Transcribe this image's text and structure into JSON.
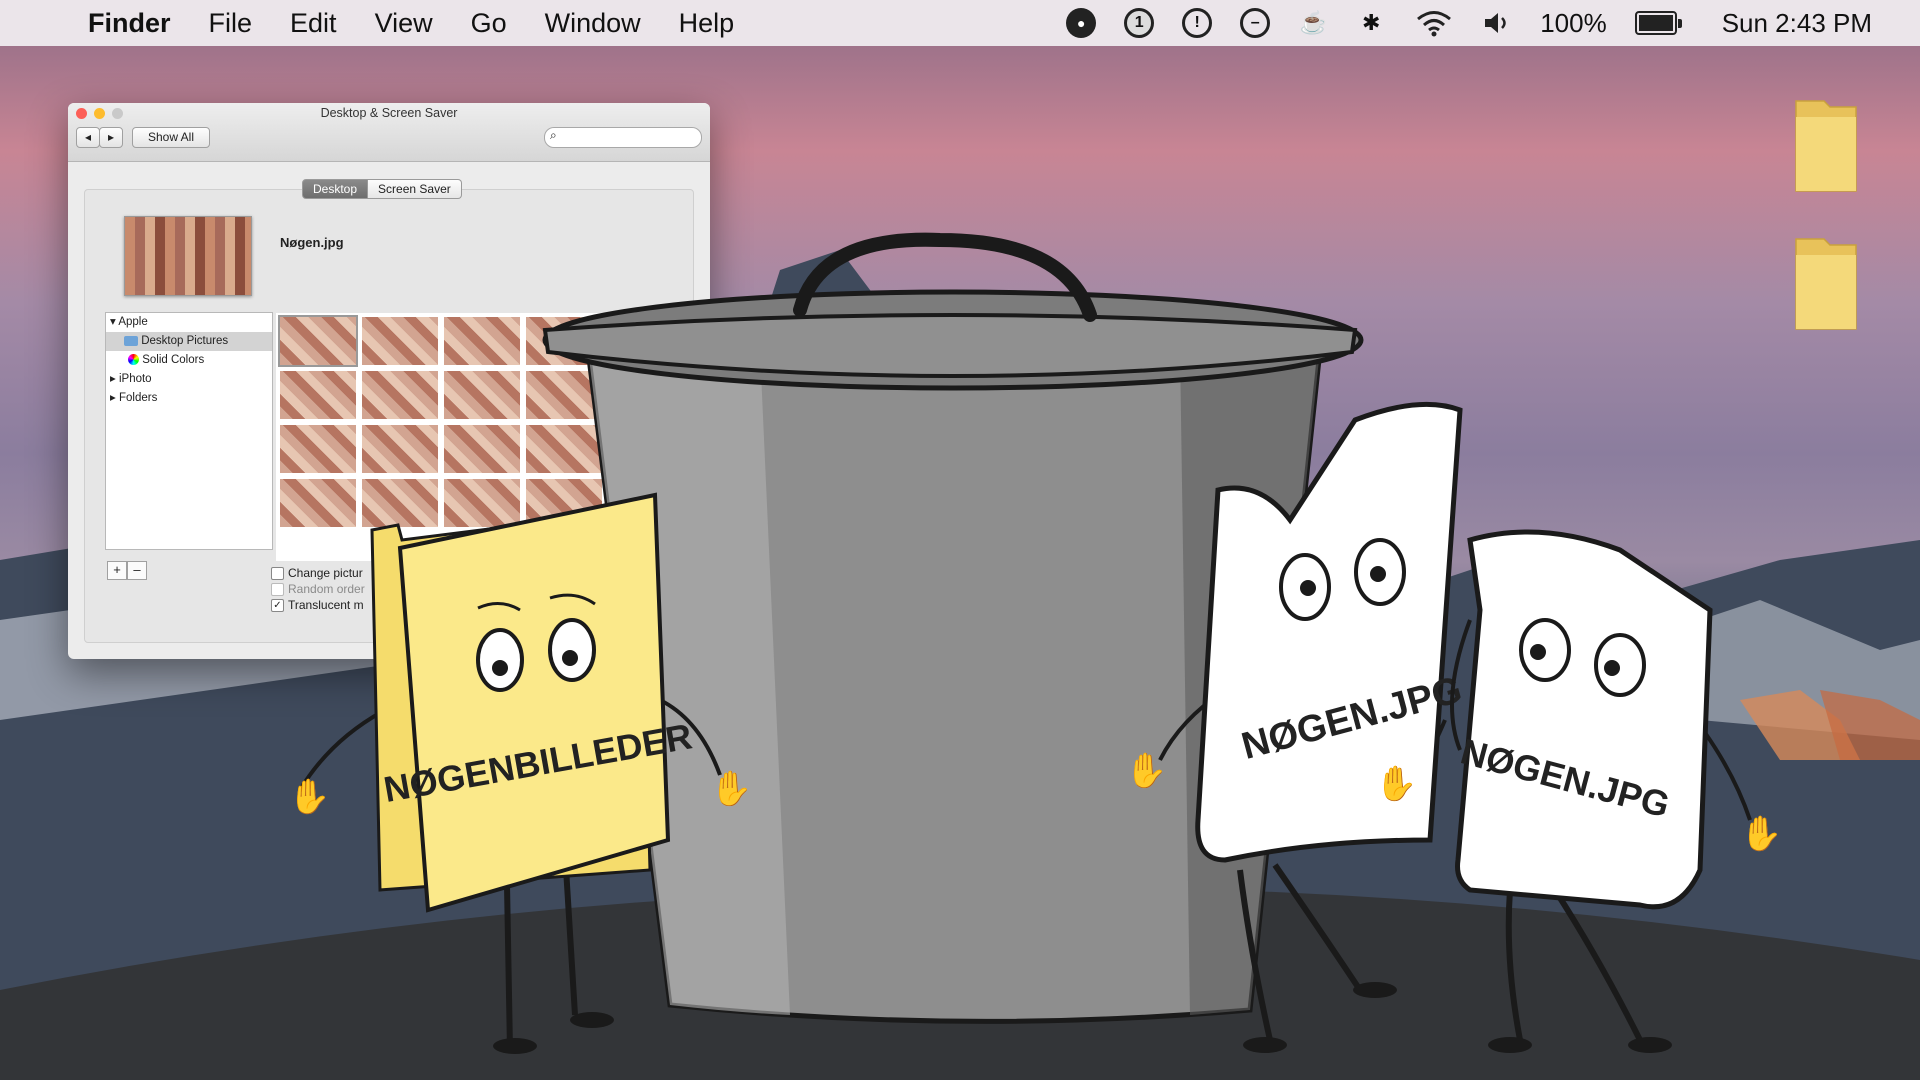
{
  "menubar": {
    "apple_glyph": "",
    "app_name": "Finder",
    "menus": [
      "File",
      "Edit",
      "View",
      "Go",
      "Window",
      "Help"
    ],
    "status": {
      "one_password_badge": "1",
      "battery_percent": "100%",
      "battery_level": 1.0,
      "clock": "Sun 2:43 PM"
    }
  },
  "prefs_window": {
    "title": "Desktop & Screen Saver",
    "show_all_label": "Show All",
    "search_placeholder": "",
    "tabs": [
      "Desktop",
      "Screen Saver"
    ],
    "active_tab": "Desktop",
    "current_picture": "Nøgen.jpg",
    "sources": {
      "group_apple": "Apple",
      "desktop_pictures": "Desktop Pictures",
      "solid_colors": "Solid Colors",
      "iphoto": "iPhoto",
      "folders": "Folders"
    },
    "buttons": {
      "add": "+",
      "remove": "–"
    },
    "options": {
      "change_picture": "Change pictur",
      "random_order": "Random order",
      "translucent_menu": "Translucent m"
    },
    "translucent_checked_glyph": "✓"
  },
  "scene": {
    "folder_character_label": "NØGENBILLEDER",
    "file_character_1_label": "NØGEN.JPG",
    "file_character_2_label": "NØGEN.JPG"
  },
  "colors": {
    "folder_yellow": "#fbe98a",
    "trash_gray": "#8a8a8a",
    "menubar": "#eeeaee"
  }
}
